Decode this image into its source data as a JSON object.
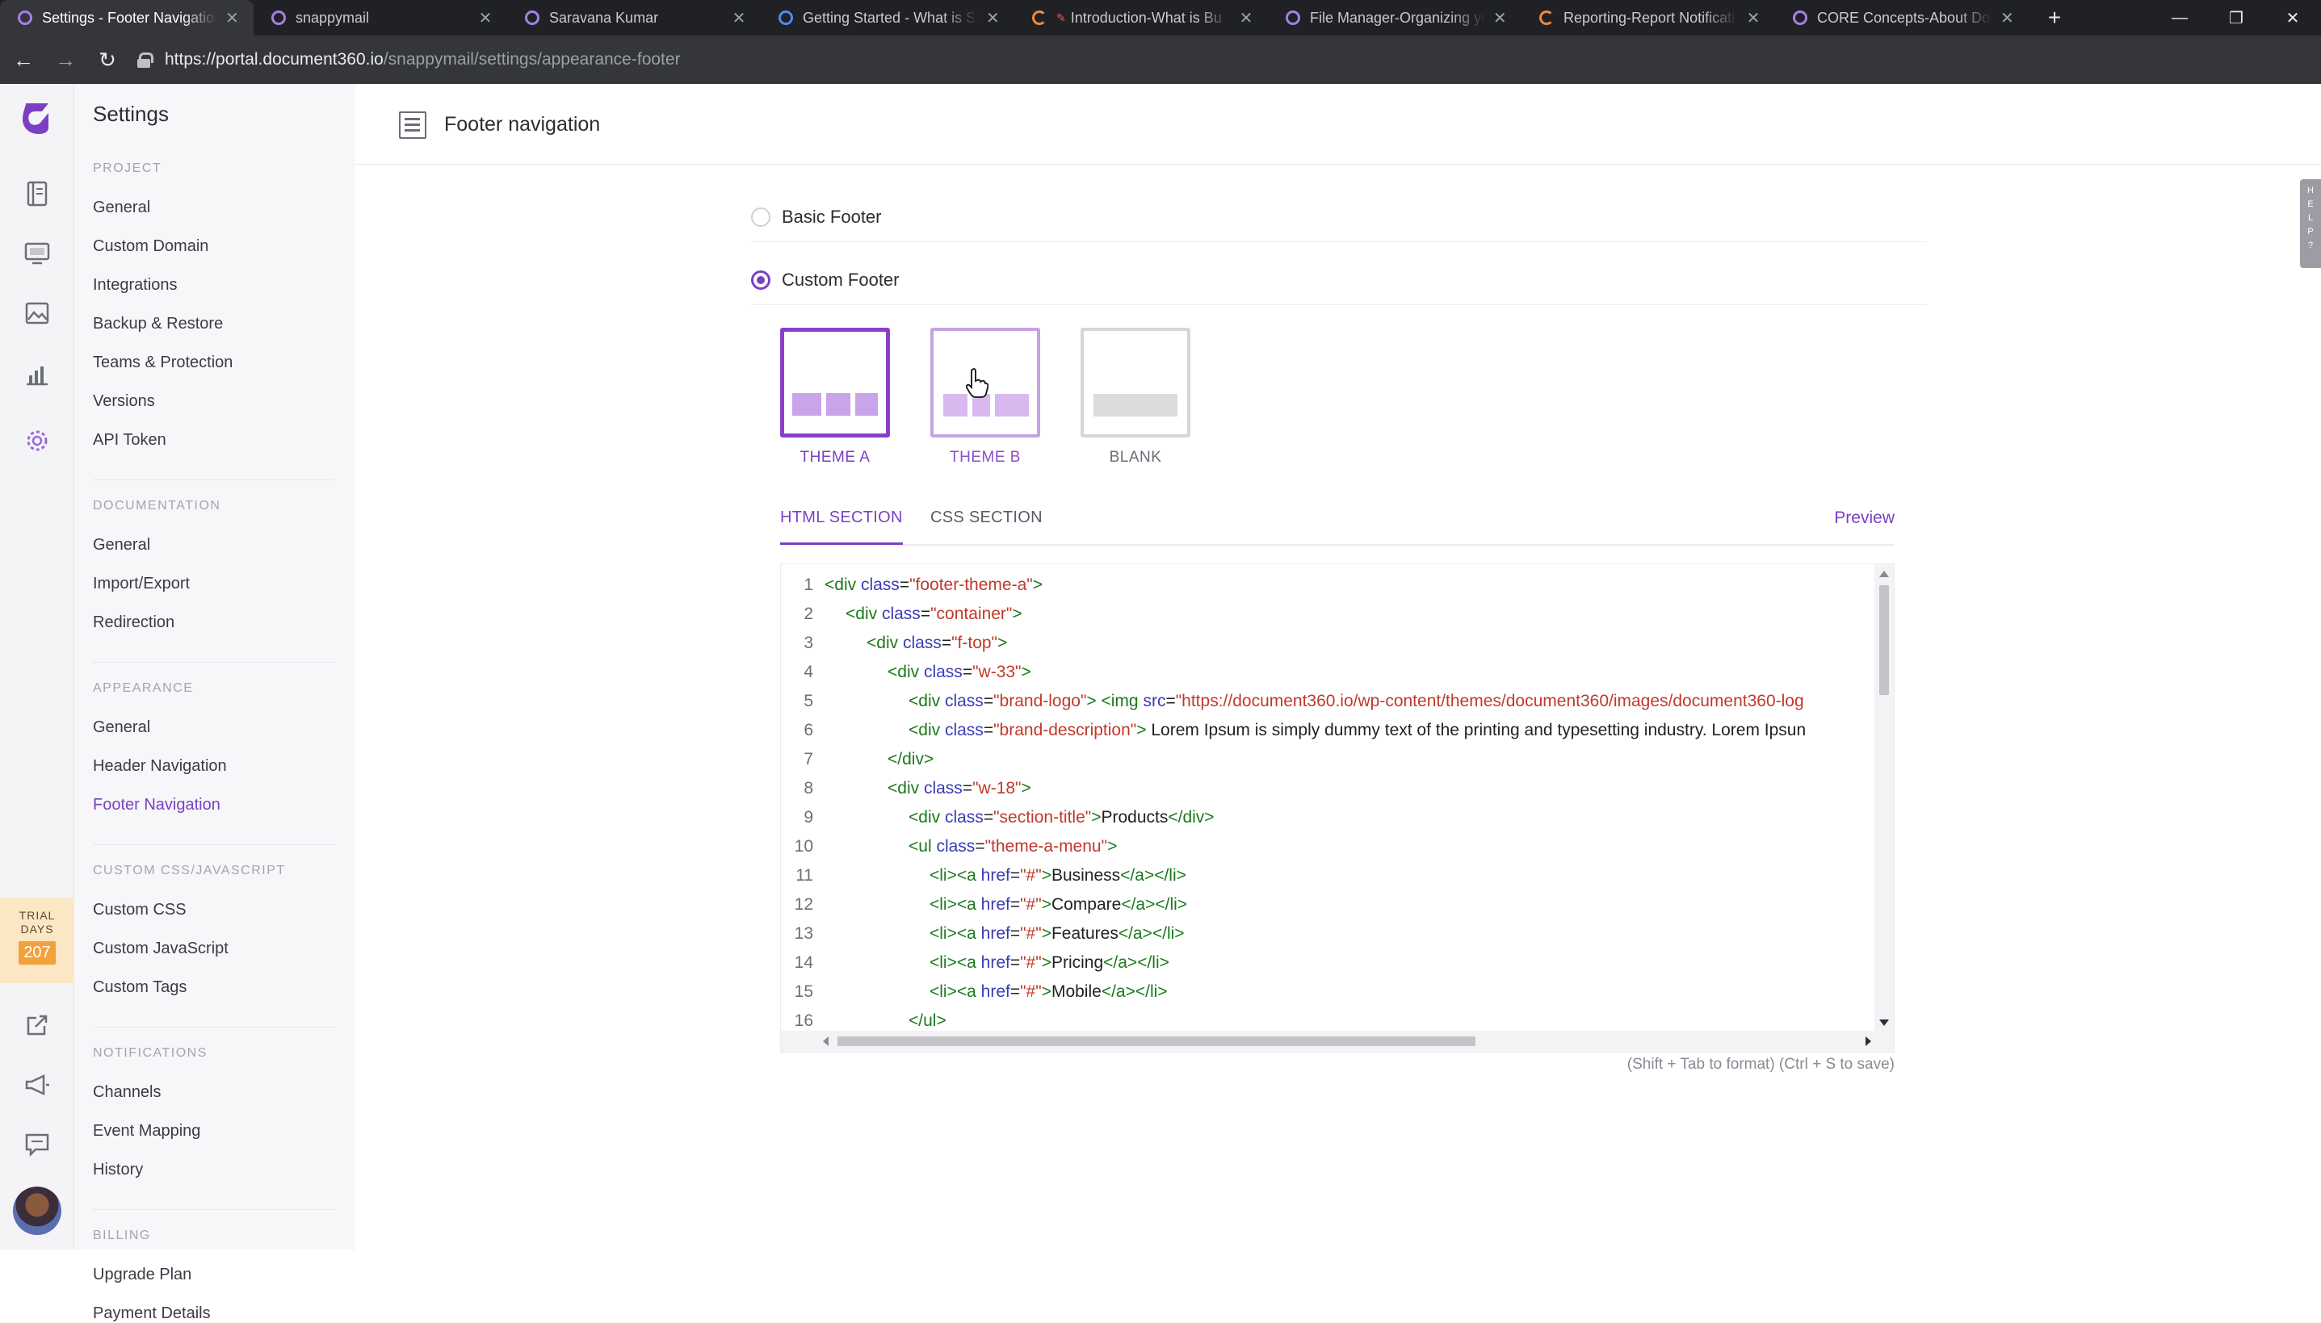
{
  "browser": {
    "tabs": [
      {
        "title": "Settings - Footer Navigation",
        "active": true,
        "icon": "document360-icon"
      },
      {
        "title": "snappymail",
        "active": false,
        "icon": "document360-icon"
      },
      {
        "title": "Saravana Kumar",
        "active": false,
        "icon": "document360-icon"
      },
      {
        "title": "Getting Started - What is Sc",
        "active": false,
        "icon": "globe-icon"
      },
      {
        "title": "Introduction-What is Bu",
        "active": false,
        "icon": "loading-icon"
      },
      {
        "title": "File Manager-Organizing yo",
        "active": false,
        "icon": "document360-icon"
      },
      {
        "title": "Reporting-Report Notificati",
        "active": false,
        "icon": "loading-icon"
      },
      {
        "title": "CORE Concepts-About Doc",
        "active": false,
        "icon": "document360-icon"
      }
    ],
    "tab_close_glyph": "✕",
    "new_tab_glyph": "+",
    "window_controls": {
      "minimize": "—",
      "maximize": "❐",
      "close": "✕"
    },
    "url_host": "https://portal.document360.io",
    "url_path": "/snappymail/settings/appearance-footer",
    "nav": {
      "back": "←",
      "forward": "→",
      "reload": "↻"
    }
  },
  "rail": {
    "icons": [
      "document360-logo",
      "documents-icon",
      "monitor-icon",
      "image-icon",
      "analytics-icon",
      "settings-icon",
      "external-link-icon",
      "megaphone-icon",
      "feedback-icon"
    ],
    "trial_label_1": "TRIAL",
    "trial_label_2": "DAYS",
    "trial_days": "207"
  },
  "settings_nav": {
    "title": "Settings",
    "sections": [
      {
        "label": "PROJECT",
        "items": [
          "General",
          "Custom Domain",
          "Integrations",
          "Backup & Restore",
          "Teams & Protection",
          "Versions",
          "API Token"
        ]
      },
      {
        "label": "DOCUMENTATION",
        "items": [
          "General",
          "Import/Export",
          "Redirection"
        ]
      },
      {
        "label": "APPEARANCE",
        "items": [
          "General",
          "Header Navigation",
          "Footer Navigation"
        ]
      },
      {
        "label": "CUSTOM CSS/JAVASCRIPT",
        "items": [
          "Custom CSS",
          "Custom JavaScript",
          "Custom Tags"
        ]
      },
      {
        "label": "NOTIFICATIONS",
        "items": [
          "Channels",
          "Event Mapping",
          "History"
        ]
      },
      {
        "label": "BILLING",
        "items": [
          "Upgrade Plan",
          "Payment Details"
        ]
      }
    ],
    "active_item": "Footer Navigation"
  },
  "page": {
    "title": "Footer navigation",
    "help_tab": "HELP?",
    "footer_options": [
      {
        "label": "Basic Footer",
        "selected": false
      },
      {
        "label": "Custom Footer",
        "selected": true
      }
    ],
    "themes": [
      {
        "label": "THEME A",
        "selected": true
      },
      {
        "label": "THEME B",
        "selected": false
      },
      {
        "label": "BLANK",
        "selected": false
      }
    ],
    "section_tabs": [
      "HTML SECTION",
      "CSS SECTION"
    ],
    "active_section_tab": "HTML SECTION",
    "preview_label": "Preview",
    "editor_hint": "(Shift + Tab to format)    (Ctrl + S to save)"
  },
  "code": [
    {
      "n": "1",
      "indent": 0,
      "parts": [
        [
          "t",
          "<div "
        ],
        [
          "a",
          "class"
        ],
        [
          "p",
          "="
        ],
        [
          "v",
          "\"footer-theme-a\""
        ],
        [
          "t",
          ">"
        ]
      ]
    },
    {
      "n": "2",
      "indent": 1,
      "parts": [
        [
          "t",
          "<div "
        ],
        [
          "a",
          "class"
        ],
        [
          "p",
          "="
        ],
        [
          "v",
          "\"container\""
        ],
        [
          "t",
          ">"
        ]
      ]
    },
    {
      "n": "3",
      "indent": 2,
      "parts": [
        [
          "t",
          "<div "
        ],
        [
          "a",
          "class"
        ],
        [
          "p",
          "="
        ],
        [
          "v",
          "\"f-top\""
        ],
        [
          "t",
          ">"
        ]
      ]
    },
    {
      "n": "4",
      "indent": 3,
      "parts": [
        [
          "t",
          "<div "
        ],
        [
          "a",
          "class"
        ],
        [
          "p",
          "="
        ],
        [
          "v",
          "\"w-33\""
        ],
        [
          "t",
          ">"
        ]
      ]
    },
    {
      "n": "5",
      "indent": 4,
      "parts": [
        [
          "t",
          "<div "
        ],
        [
          "a",
          "class"
        ],
        [
          "p",
          "="
        ],
        [
          "v",
          "\"brand-logo\""
        ],
        [
          "t",
          "> <img "
        ],
        [
          "a",
          "src"
        ],
        [
          "p",
          "="
        ],
        [
          "v",
          "\"https://document360.io/wp-content/themes/document360/images/document360-log"
        ]
      ]
    },
    {
      "n": "6",
      "indent": 4,
      "parts": [
        [
          "t",
          "<div "
        ],
        [
          "a",
          "class"
        ],
        [
          "p",
          "="
        ],
        [
          "v",
          "\"brand-description\""
        ],
        [
          "t",
          ">"
        ],
        [
          "p",
          " Lorem Ipsum is simply dummy text of the printing and typesetting industry. Lorem Ipsun"
        ]
      ]
    },
    {
      "n": "7",
      "indent": 3,
      "parts": [
        [
          "t",
          "</div>"
        ]
      ]
    },
    {
      "n": "8",
      "indent": 3,
      "parts": [
        [
          "t",
          "<div "
        ],
        [
          "a",
          "class"
        ],
        [
          "p",
          "="
        ],
        [
          "v",
          "\"w-18\""
        ],
        [
          "t",
          ">"
        ]
      ]
    },
    {
      "n": "9",
      "indent": 4,
      "parts": [
        [
          "t",
          "<div "
        ],
        [
          "a",
          "class"
        ],
        [
          "p",
          "="
        ],
        [
          "v",
          "\"section-title\""
        ],
        [
          "t",
          ">"
        ],
        [
          "p",
          "Products"
        ],
        [
          "t",
          "</div>"
        ]
      ]
    },
    {
      "n": "10",
      "indent": 4,
      "parts": [
        [
          "t",
          "<ul "
        ],
        [
          "a",
          "class"
        ],
        [
          "p",
          "="
        ],
        [
          "v",
          "\"theme-a-menu\""
        ],
        [
          "t",
          ">"
        ]
      ]
    },
    {
      "n": "11",
      "indent": 5,
      "parts": [
        [
          "t",
          "<li><a "
        ],
        [
          "a",
          "href"
        ],
        [
          "p",
          "="
        ],
        [
          "v",
          "\"#\""
        ],
        [
          "t",
          ">"
        ],
        [
          "p",
          "Business"
        ],
        [
          "t",
          "</a></li>"
        ]
      ]
    },
    {
      "n": "12",
      "indent": 5,
      "parts": [
        [
          "t",
          "<li><a "
        ],
        [
          "a",
          "href"
        ],
        [
          "p",
          "="
        ],
        [
          "v",
          "\"#\""
        ],
        [
          "t",
          ">"
        ],
        [
          "p",
          "Compare"
        ],
        [
          "t",
          "</a></li>"
        ]
      ]
    },
    {
      "n": "13",
      "indent": 5,
      "parts": [
        [
          "t",
          "<li><a "
        ],
        [
          "a",
          "href"
        ],
        [
          "p",
          "="
        ],
        [
          "v",
          "\"#\""
        ],
        [
          "t",
          ">"
        ],
        [
          "p",
          "Features"
        ],
        [
          "t",
          "</a></li>"
        ]
      ]
    },
    {
      "n": "14",
      "indent": 5,
      "parts": [
        [
          "t",
          "<li><a "
        ],
        [
          "a",
          "href"
        ],
        [
          "p",
          "="
        ],
        [
          "v",
          "\"#\""
        ],
        [
          "t",
          ">"
        ],
        [
          "p",
          "Pricing"
        ],
        [
          "t",
          "</a></li>"
        ]
      ]
    },
    {
      "n": "15",
      "indent": 5,
      "parts": [
        [
          "t",
          "<li><a "
        ],
        [
          "a",
          "href"
        ],
        [
          "p",
          "="
        ],
        [
          "v",
          "\"#\""
        ],
        [
          "t",
          ">"
        ],
        [
          "p",
          "Mobile"
        ],
        [
          "t",
          "</a></li>"
        ]
      ]
    },
    {
      "n": "16",
      "indent": 4,
      "parts": [
        [
          "t",
          "</ul>"
        ]
      ]
    }
  ],
  "colors": {
    "accent": "#7b3fc4",
    "theme_block": "#c9a4e8",
    "blank_block": "#dcdcdf",
    "tag": "#1a7a1a",
    "attr": "#3a3ab8",
    "value": "#c0392b"
  }
}
